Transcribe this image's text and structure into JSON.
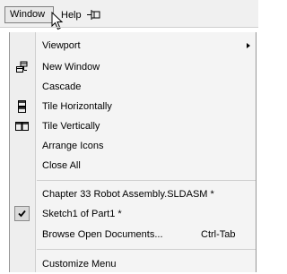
{
  "menubar": {
    "window_label": "Window",
    "help_label": "Help",
    "pin_icon": "pin-icon",
    "cursor_icon": "mouse-pointer-icon"
  },
  "menu": {
    "items": [
      {
        "label": "Viewport",
        "has_submenu": true
      },
      {
        "label": "New Window",
        "icon": "new-window-icon"
      },
      {
        "label": "Cascade"
      },
      {
        "label": "Tile Horizontally",
        "icon": "tile-horizontal-icon"
      },
      {
        "label": "Tile Vertically",
        "icon": "tile-vertical-icon"
      },
      {
        "label": "Arrange Icons"
      },
      {
        "label": "Close All"
      },
      {
        "label": "Chapter 33 Robot Assembly.SLDASM *"
      },
      {
        "label": "Sketch1 of Part1 *",
        "checked": true
      },
      {
        "label": "Browse Open Documents...",
        "shortcut": "Ctrl-Tab"
      },
      {
        "label": "Customize Menu"
      }
    ]
  }
}
